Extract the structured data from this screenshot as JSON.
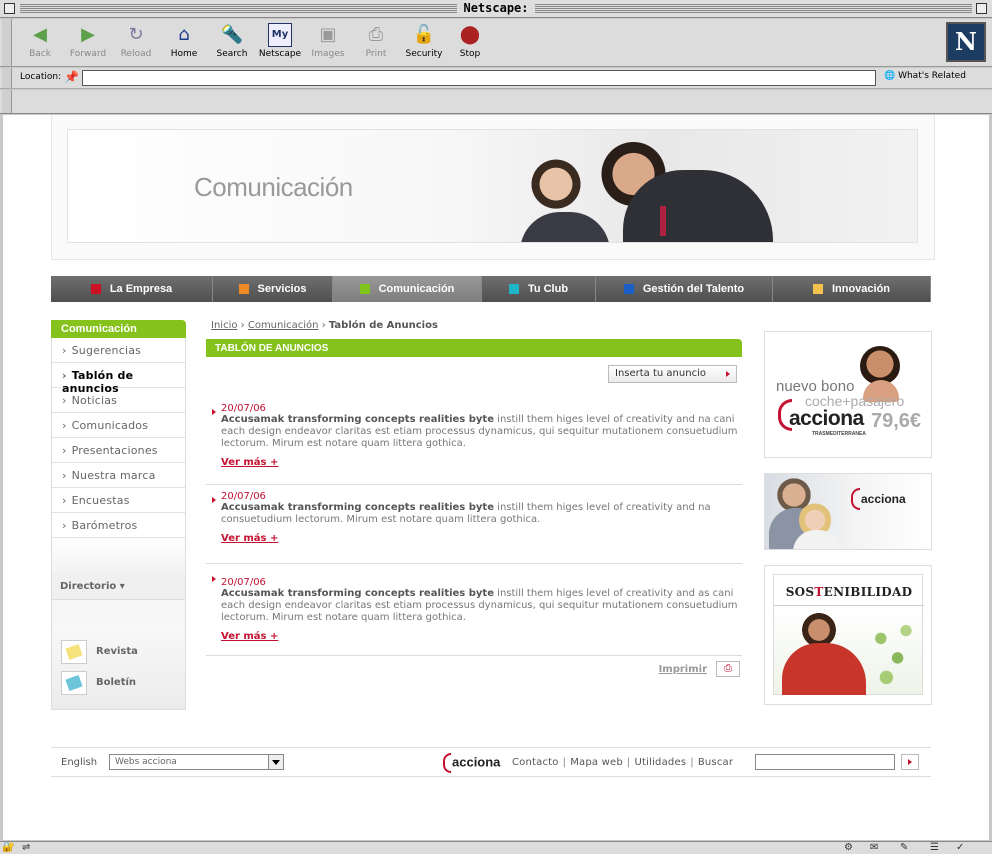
{
  "browser": {
    "title": "Netscape:",
    "toolbar": [
      {
        "label": "Back",
        "icon": "back-arrow-icon",
        "glyph": "◀",
        "color": "#5da04a",
        "disabled": true
      },
      {
        "label": "Forward",
        "icon": "forward-arrow-icon",
        "glyph": "▶",
        "color": "#5da04a",
        "disabled": true
      },
      {
        "label": "Reload",
        "icon": "reload-icon",
        "glyph": "↻",
        "color": "#7a7aa0",
        "disabled": true
      },
      {
        "label": "Home",
        "icon": "home-icon",
        "glyph": "⌂",
        "color": "#1d3c8a",
        "disabled": false
      },
      {
        "label": "Search",
        "icon": "search-icon",
        "glyph": "🔦",
        "color": "#3355aa",
        "disabled": false
      },
      {
        "label": "Netscape",
        "icon": "netscape-icon",
        "glyph": "My",
        "color": "#223366",
        "disabled": false
      },
      {
        "label": "Images",
        "icon": "images-icon",
        "glyph": "▣",
        "color": "#999999",
        "disabled": true
      },
      {
        "label": "Print",
        "icon": "print-icon",
        "glyph": "⎙",
        "color": "#999999",
        "disabled": true
      },
      {
        "label": "Security",
        "icon": "lock-icon",
        "glyph": "🔓",
        "color": "#aa2244",
        "disabled": false
      },
      {
        "label": "Stop",
        "icon": "stop-icon",
        "glyph": "⬤",
        "color": "#aa2222",
        "disabled": false
      }
    ],
    "location_label": "Location:",
    "location_value": "",
    "whats_related": "What's Related"
  },
  "page": {
    "banner_title": "Comunicación",
    "nav": [
      {
        "label": "La Empresa",
        "color": "#cc1122",
        "width": 162,
        "active": false
      },
      {
        "label": "Servicios",
        "color": "#f08a24",
        "width": 120,
        "active": false
      },
      {
        "label": "Comunicación",
        "color": "#7fc31c",
        "width": 149,
        "active": true
      },
      {
        "label": "Tu Club",
        "color": "#1eb5c8",
        "width": 114,
        "active": false
      },
      {
        "label": "Gestión del Talento",
        "color": "#1a5fc8",
        "width": 177,
        "active": false
      },
      {
        "label": "Innovación",
        "color": "#f2c14e",
        "width": 158,
        "active": false
      }
    ],
    "sidebar": {
      "heading": "Comunicación",
      "items": [
        "Sugerencias",
        "Tablón de anuncios",
        "Noticias",
        "Comunicados",
        "Presentaciones",
        "Nuestra marca",
        "Encuestas",
        "Barómetros"
      ],
      "active_index": 1,
      "directorio": "Directorio ▾",
      "publications": [
        {
          "label": "Revista",
          "icon": "revista-icon",
          "color": "#f5e27a"
        },
        {
          "label": "Boletín",
          "icon": "boletin-icon",
          "color": "#6cc5d8"
        }
      ]
    },
    "breadcrumb": {
      "inicio": "Inicio",
      "sep": "›",
      "comunicacion": "Comunicación",
      "current": "Tablón de Anuncios"
    },
    "section_title": "TABLÓN DE ANUNCIOS",
    "insert_button": "Inserta tu anuncio",
    "ads": [
      {
        "date": "20/07/06",
        "lead": "Accusamak transforming concepts realities byte",
        "body": " instill them higes level of creativity and na cani each design endeavor claritas est etiam processus dynamicus, qui sequitur mutationem consuetudium lectorum. Mirum est notare quam littera gothica.",
        "more": "Ver más +"
      },
      {
        "date": "20/07/06",
        "lead": "Accusamak transforming concepts realities byte",
        "body": " instill them higes level of creativity and na consuetudium lectorum. Mirum est notare quam littera gothica.",
        "more": "Ver más +"
      },
      {
        "date": "20/07/06",
        "lead": "Accusamak transforming concepts realities byte",
        "body": " instill them higes level of creativity and as cani each design endeavor claritas est etiam processus dynamicus, qui sequitur mutationem consuetudium lectorum. Mirum est notare quam littera gothica.",
        "more": "Ver más +"
      }
    ],
    "print_label": "Imprimir",
    "promos": {
      "bono_line1": "nuevo bono",
      "bono_line2": "coche+pasajero",
      "bono_brand": "acciona",
      "bono_sub": "TRASMEDITERRANEA",
      "bono_price": "79,6€",
      "team_brand": "acciona",
      "sost_pre": "SOS",
      "sost_t": "T",
      "sost_post": "ENIBILIDAD"
    },
    "footer": {
      "language": "English",
      "webs_select": "Webs acciona",
      "brand": "acciona",
      "links": [
        "Contacto",
        "Mapa web",
        "Utilidades",
        "Buscar"
      ],
      "search_value": ""
    }
  }
}
